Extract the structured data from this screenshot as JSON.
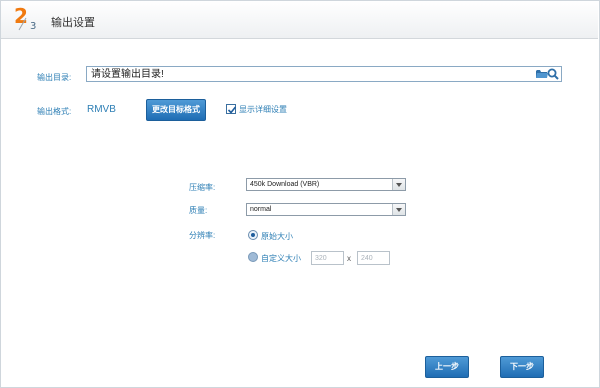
{
  "header": {
    "step_current": "2",
    "step_total": "3",
    "title": "输出设置"
  },
  "output_dir": {
    "label": "输出目录:",
    "value": "请设置输出目录!",
    "icons": [
      "folder-icon",
      "search-icon"
    ]
  },
  "output_format": {
    "label": "输出格式:",
    "value": "RMVB",
    "change_button": "更改目标格式",
    "show_details_checked": true,
    "show_details_label": "显示详细设置"
  },
  "details": {
    "compression_label": "压缩率:",
    "compression_value": "450k Download (VBR)",
    "quality_label": "质量:",
    "quality_value": "normal",
    "resolution_label": "分辨率:",
    "resolution_original": "原始大小",
    "resolution_custom": "自定义大小",
    "resolution_selected": "original",
    "custom_width": "320",
    "custom_height": "240",
    "times_sign": "x"
  },
  "nav": {
    "prev": "上一步",
    "next": "下一步"
  },
  "colors": {
    "step_accent": "#f07a10",
    "label_blue": "#2e7fb5",
    "button_blue": "#1f6db4"
  }
}
